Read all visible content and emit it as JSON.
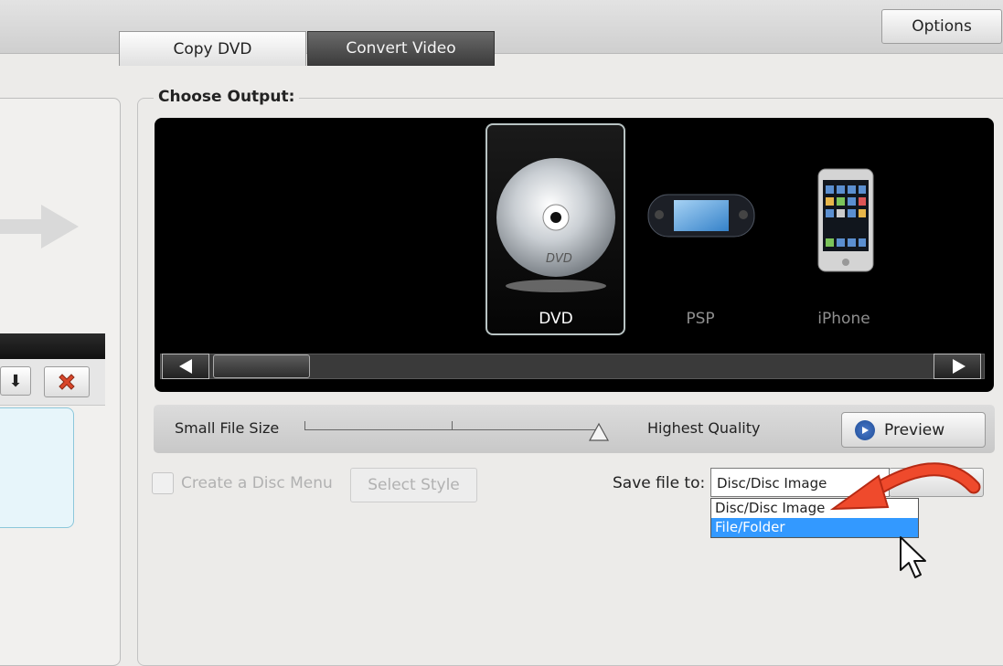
{
  "toolbar": {
    "options_label": "Options"
  },
  "tabs": [
    {
      "label": "Copy DVD",
      "active": false
    },
    {
      "label": "Convert Video",
      "active": true
    }
  ],
  "output": {
    "legend": "Choose Output:",
    "devices": [
      {
        "label": "DVD",
        "selected": true,
        "icon": "dvd-disc-icon"
      },
      {
        "label": "PSP",
        "selected": false,
        "icon": "psp-icon"
      },
      {
        "label": "iPhone",
        "selected": false,
        "icon": "iphone-icon"
      }
    ]
  },
  "quality": {
    "min_label": "Small File Size",
    "max_label": "Highest Quality",
    "level": 1.0,
    "preview_label": "Preview"
  },
  "disc_menu": {
    "checkbox_label": "Create a Disc Menu",
    "checked": false,
    "select_style_label": "Select Style"
  },
  "save": {
    "label": "Save file to:",
    "value": "Disc/Disc Image",
    "options": [
      "Disc/Disc Image",
      "File/Folder"
    ],
    "highlighted": "File/Folder"
  },
  "colors": {
    "accent": "#3399ff",
    "annotation_arrow": "#e8402a",
    "tab_active": "#3c3c3c"
  }
}
